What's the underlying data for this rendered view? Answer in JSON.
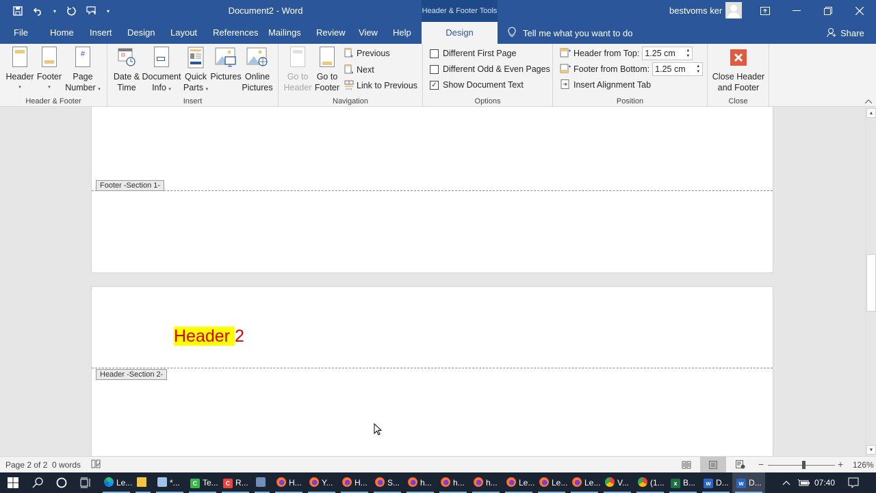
{
  "window": {
    "title": "Document2  -  Word",
    "context_tools_title": "Header & Footer Tools",
    "user_name": "bestvoms ker",
    "colors": {
      "titlebar": "#2b579a",
      "accent": "#2b579a",
      "close_button": "#e05a3d",
      "header_text": "#e00000",
      "highlight": "#ffff00"
    }
  },
  "qat": {
    "save_icon": "save-icon",
    "undo_icon": "undo-icon",
    "redo_icon": "repeat-icon",
    "touch_icon": "touch-mode-icon",
    "customize_icon": "customize-qat-icon"
  },
  "tabs": [
    {
      "label": "File"
    },
    {
      "label": "Home"
    },
    {
      "label": "Insert"
    },
    {
      "label": "Design"
    },
    {
      "label": "Layout"
    },
    {
      "label": "References"
    },
    {
      "label": "Mailings"
    },
    {
      "label": "Review"
    },
    {
      "label": "View"
    },
    {
      "label": "Help"
    },
    {
      "label": "Design",
      "active": true
    }
  ],
  "tell_me": "Tell me what you want to do",
  "share": "Share",
  "ribbon": {
    "header_footer": {
      "label": "Header & Footer",
      "header": "Header",
      "footer": "Footer",
      "page_number_1": "Page",
      "page_number_2": "Number"
    },
    "insert": {
      "label": "Insert",
      "date_time_1": "Date &",
      "date_time_2": "Time",
      "document_info_1": "Document",
      "document_info_2": "Info",
      "quick_parts_1": "Quick",
      "quick_parts_2": "Parts",
      "pictures": "Pictures",
      "online_pictures_1": "Online",
      "online_pictures_2": "Pictures"
    },
    "navigation": {
      "label": "Navigation",
      "go_to_header_1": "Go to",
      "go_to_header_2": "Header",
      "go_to_footer_1": "Go to",
      "go_to_footer_2": "Footer",
      "previous": "Previous",
      "next": "Next",
      "link_to_previous": "Link to Previous"
    },
    "options": {
      "label": "Options",
      "different_first_page": "Different First Page",
      "different_first_page_checked": false,
      "different_odd_even": "Different Odd & Even Pages",
      "different_odd_even_checked": false,
      "show_document_text": "Show Document Text",
      "show_document_text_checked": true
    },
    "position": {
      "label": "Position",
      "header_from_top_label": "Header from Top:",
      "header_from_top_value": "1.25 cm",
      "footer_from_bottom_label": "Footer from Bottom:",
      "footer_from_bottom_value": "1.25 cm",
      "insert_alignment_tab": "Insert Alignment Tab"
    },
    "close": {
      "label": "Close",
      "close_1": "Close Header",
      "close_2": "and Footer"
    }
  },
  "document": {
    "footer_tag_1": "Footer -Section 1-",
    "header_tag_2": "Header -Section 2-",
    "header_text_highlighted": "Header ",
    "header_text_rest": "2"
  },
  "status": {
    "page": "Page 2 of 2",
    "words": "0 words",
    "zoom_percent": "126%",
    "zoom_value": 126
  },
  "taskbar": {
    "items": [
      {
        "label": "Le...",
        "app": "edge"
      },
      {
        "label": "",
        "app": "file-explorer"
      },
      {
        "label": "*...",
        "app": "notepad"
      },
      {
        "label": "Te...",
        "app": "camtasia-green"
      },
      {
        "label": "R...",
        "app": "camtasia-red"
      },
      {
        "label": "",
        "app": "network"
      },
      {
        "label": "H...",
        "app": "firefox"
      },
      {
        "label": "Y...",
        "app": "firefox"
      },
      {
        "label": "H...",
        "app": "firefox"
      },
      {
        "label": "S...",
        "app": "firefox"
      },
      {
        "label": "h...",
        "app": "firefox"
      },
      {
        "label": "h...",
        "app": "firefox"
      },
      {
        "label": "h...",
        "app": "firefox"
      },
      {
        "label": "Le...",
        "app": "firefox"
      },
      {
        "label": "Le...",
        "app": "firefox"
      },
      {
        "label": "Le...",
        "app": "firefox"
      },
      {
        "label": "V...",
        "app": "chrome"
      },
      {
        "label": "(1...",
        "app": "chrome"
      },
      {
        "label": "B...",
        "app": "excel"
      },
      {
        "label": "D...",
        "app": "word"
      },
      {
        "label": "D...",
        "app": "word",
        "active": true
      }
    ],
    "clock": "07:40"
  }
}
